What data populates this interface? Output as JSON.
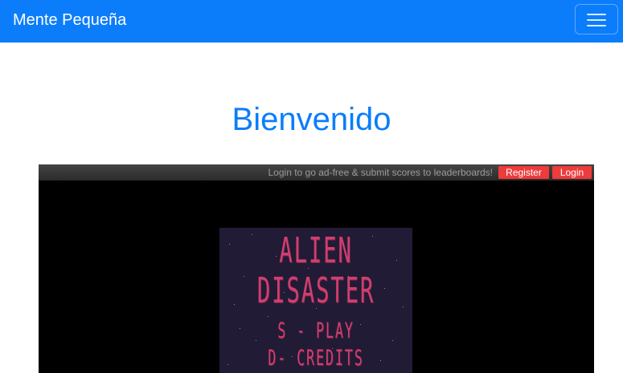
{
  "navbar": {
    "brand": "Mente Pequeña",
    "menu_icon": "hamburger-menu-icon"
  },
  "page": {
    "heading": "Bienvenido"
  },
  "game": {
    "promo_text": "Login to go ad-free & submit scores to leaderboards!",
    "register_label": "Register",
    "login_label": "Login",
    "title_line1": "ALIEN",
    "title_line2": "DISASTER",
    "play_hint": "S - PLAY",
    "credits_hint": "D- CREDITS"
  },
  "colors": {
    "primary": "#0b7dfb",
    "button_red": "#ee3b3b",
    "game_bg": "#221b36",
    "title_pink": "#cf3f6f"
  }
}
